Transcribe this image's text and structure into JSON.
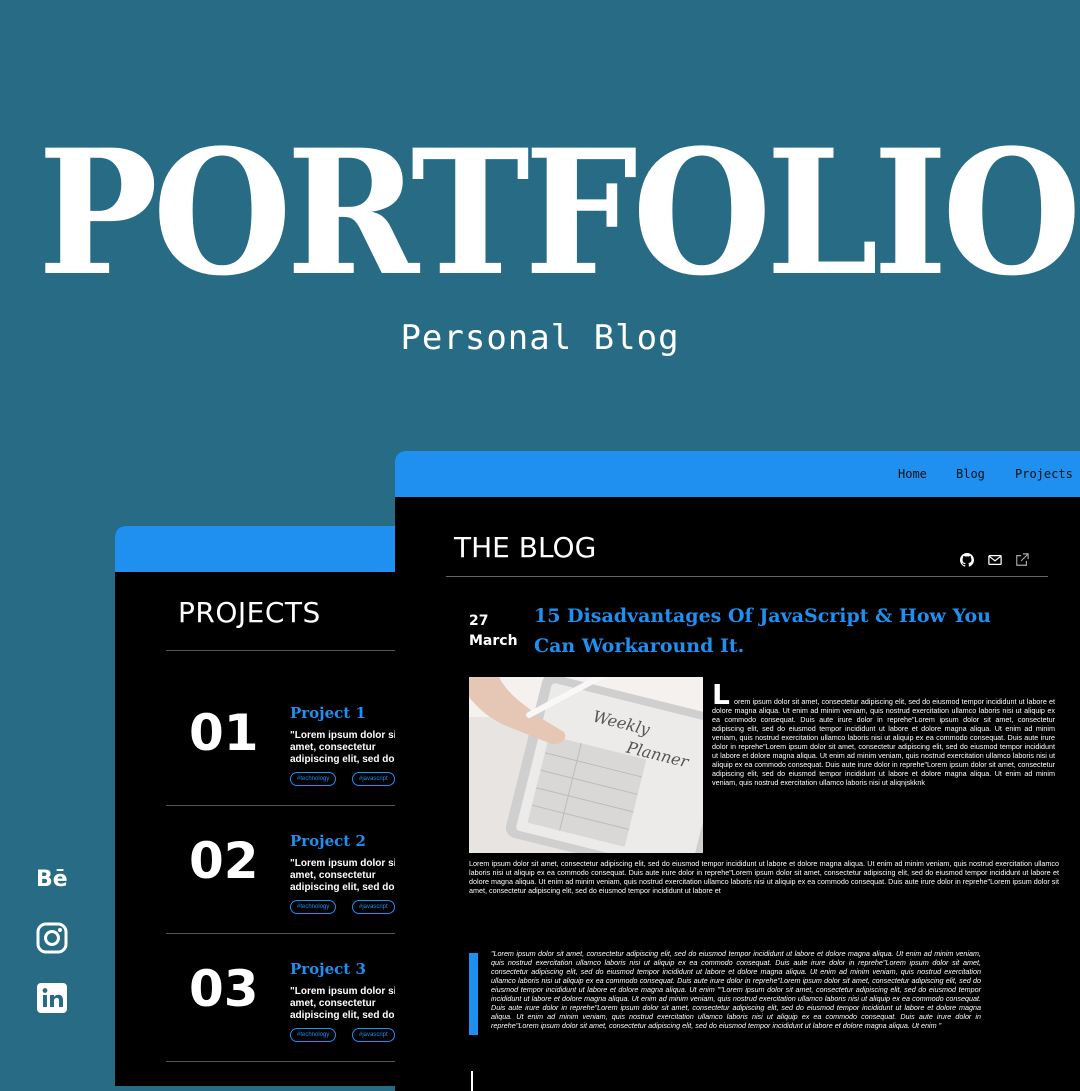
{
  "hero": {
    "title": "PORTFOLIO",
    "subtitle": "Personal Blog"
  },
  "social": [
    "behance-icon",
    "instagram-icon",
    "linkedin-icon"
  ],
  "social_labels": {
    "behance": "Bē"
  },
  "projects": {
    "heading": "PROJECTS",
    "items": [
      {
        "number": "01",
        "title": "Project 1",
        "description": "\"Lorem ipsum dolor sit amet, consectetur adipiscing elit, sed do eiusmod tempor incididunt ut labore et dolore magna aliqua. Ut enim ad minim veniam, quis nostrud exercitation ullamco laboris nisi ut aliquip ex ea commodo",
        "tags": [
          "#technology",
          "#javascript"
        ]
      },
      {
        "number": "02",
        "title": "Project 2",
        "description": "\"Lorem ipsum dolor sit amet, consectetur adipiscing elit, sed do eiusmod tempor incididunt ut labore et dolore magna aliqua. Ut enim ad minim veniam, quis nostrud exercitation ullamco laboris nisi ut aliquip ex ea commodo",
        "tags": [
          "#technology",
          "#javascript"
        ]
      },
      {
        "number": "03",
        "title": "Project 3",
        "description": "\"Lorem ipsum dolor sit amet, consectetur adipiscing elit, sed do eiusmod tempor incididunt ut labore et dolore magna aliqua. Ut enim ad minim veniam, quis nostrud exercitation ullamco laboris nisi ut aliquip ex ea commodo",
        "tags": [
          "#technology",
          "#javascript"
        ]
      }
    ]
  },
  "blog": {
    "nav": [
      "Home",
      "Blog",
      "Projects"
    ],
    "heading": "THE BLOG",
    "header_icons": [
      "github-icon",
      "mail-icon",
      "external-link-icon"
    ],
    "post": {
      "day": "27",
      "month": "March",
      "title": "15 Disadvantages Of JavaScript & How You Can Workaround It.",
      "dropcap": "L",
      "paragraph1": "orem ipsum dolor sit amet, consectetur adipiscing elit, sed do eiusmod tempor incididunt ut labore et dolore magna aliqua. Ut enim ad minim veniam, quis nostrud exercitation ullamco laboris nisi ut aliquip ex ea commodo consequat. Duis aute irure dolor in reprehe\"Lorem ipsum dolor sit amet, consectetur adipiscing elit, sed do eiusmod tempor incididunt ut labore et dolore magna aliqua. Ut enim ad minim veniam, quis nostrud exercitation ullamco laboris nisi ut aliquip ex ea commodo consequat. Duis aute irure dolor in reprehe\"Lorem ipsum dolor sit amet, consectetur adipiscing elit, sed do eiusmod tempor incididunt ut labore et dolore magna aliqua. Ut enim ad minim veniam, quis nostrud exercitation ullamco laboris nisi ut aliquip ex ea commodo consequat. Duis aute irure dolor in reprehe\"Lorem ipsum dolor sit amet, consectetur adipiscing elit, sed do eiusmod tempor incididunt ut labore et dolore magna aliqua. Ut enim ad minim veniam, quis nostrud exercitation ullamco laboris nisi ut aliqnjskknk",
      "paragraph2": "Lorem ipsum dolor sit amet, consectetur adipiscing elit, sed do eiusmod tempor incididunt ut labore et dolore magna aliqua. Ut enim ad minim veniam, quis nostrud exercitation ullamco laboris nisi ut aliquip ex ea commodo consequat. Duis aute irure dolor in reprehe\"Lorem ipsum dolor sit amet, consectetur adipiscing elit, sed do eiusmod tempor incididunt ut labore et dolore magna aliqua. Ut enim ad minim veniam, quis nostrud exercitation ullamco laboris nisi ut aliquip ex ea commodo consequat. Duis aute irure dolor in reprehe\"Lorem ipsum dolor sit amet, consectetur adipiscing elit, sed do eiusmod tempor incididunt ut labore et",
      "quote": "\"Lorem ipsum dolor sit amet, consectetur adipiscing elit, sed do eiusmod tempor incididunt ut labore et dolore magna aliqua. Ut enim ad minim veniam, quis nostrud exercitation ullamco laboris nisi ut aliquip ex ea commodo consequat. Duis aute irure dolor in reprehe\"Lorem ipsum dolor sit amet, consectetur adipiscing elit, sed do eiusmod tempor incididunt ut labore et dolore magna aliqua. Ut enim ad minim veniam, quis nostrud exercitation ullamco laboris nisi ut aliquip ex ea commodo consequat. Duis aute irure dolor in reprehe\"Lorem ipsum dolor sit amet, consectetur adipiscing elit, sed do eiusmod tempor incididunt ut labore et dolore magna aliqua. Ut enim \"\"Lorem ipsum dolor sit amet, consectetur adipiscing elit, sed do eiusmod tempor incididunt ut labore et dolore magna aliqua. Ut enim ad minim veniam, quis nostrud exercitation ullamco laboris nisi ut aliquip ex ea commodo consequat. Duis aute irure dolor in reprehe\"Lorem ipsum dolor sit amet, consectetur adipiscing elit, sed do eiusmod tempor incididunt ut labore et dolore magna aliqua. Ut enim ad minim veniam, quis nostrud exercitation ullamco laboris nisi ut aliquip ex ea commodo consequat. Duis aute irure dolor in reprehe\"Lorem ipsum dolor sit amet, consectetur adipiscing elit, sed do eiusmod tempor incididunt ut labore et dolore magna aliqua. Ut enim \"",
      "image_text": [
        "Weekly",
        "Planner"
      ]
    }
  },
  "colors": {
    "background": "#276b85",
    "accent": "#1f8ff0",
    "panel": "#000000",
    "text": "#ffffff"
  }
}
